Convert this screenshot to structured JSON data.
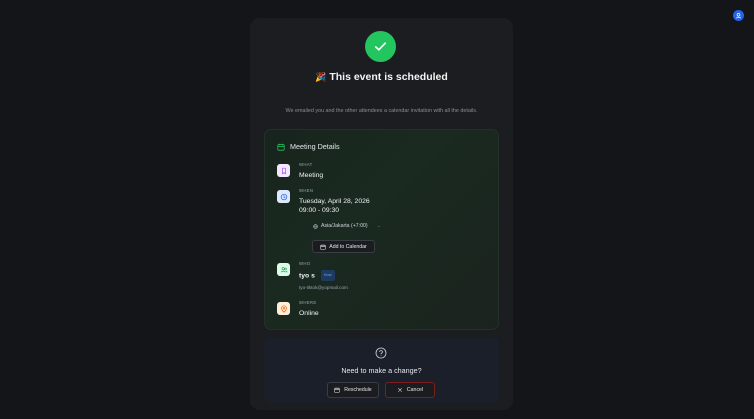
{
  "header": {
    "title": "This event is scheduled",
    "emoji": "🎉",
    "subtitle": "We emailed you and the other attendees a calendar invitation with all the details."
  },
  "details": {
    "heading": "Meeting Details",
    "what": {
      "label": "WHAT",
      "value": "Meeting"
    },
    "when": {
      "label": "WHEN",
      "date": "Tuesday, April 28, 2026",
      "time": "09:00 - 09:30",
      "timezone": "Asia/Jakarta (+7:00)",
      "add_to_calendar": "Add to Calendar"
    },
    "who": {
      "label": "WHO",
      "name": "tyo s",
      "badge": "Host",
      "email": "tyo-tiktok@yopmail.com"
    },
    "where": {
      "label": "WHERE",
      "value": "Online"
    }
  },
  "change": {
    "prompt": "Need to make a change?",
    "reschedule_label": "Reschedule",
    "cancel_label": "Cancel"
  },
  "colors": {
    "accent_green": "#22c55e",
    "accent_blue": "#2563eb",
    "what_icon_bg": "#f3e8ff",
    "when_icon_bg": "#dbeafe",
    "who_icon_bg": "#dcfce7",
    "where_icon_bg": "#ffedd5"
  }
}
